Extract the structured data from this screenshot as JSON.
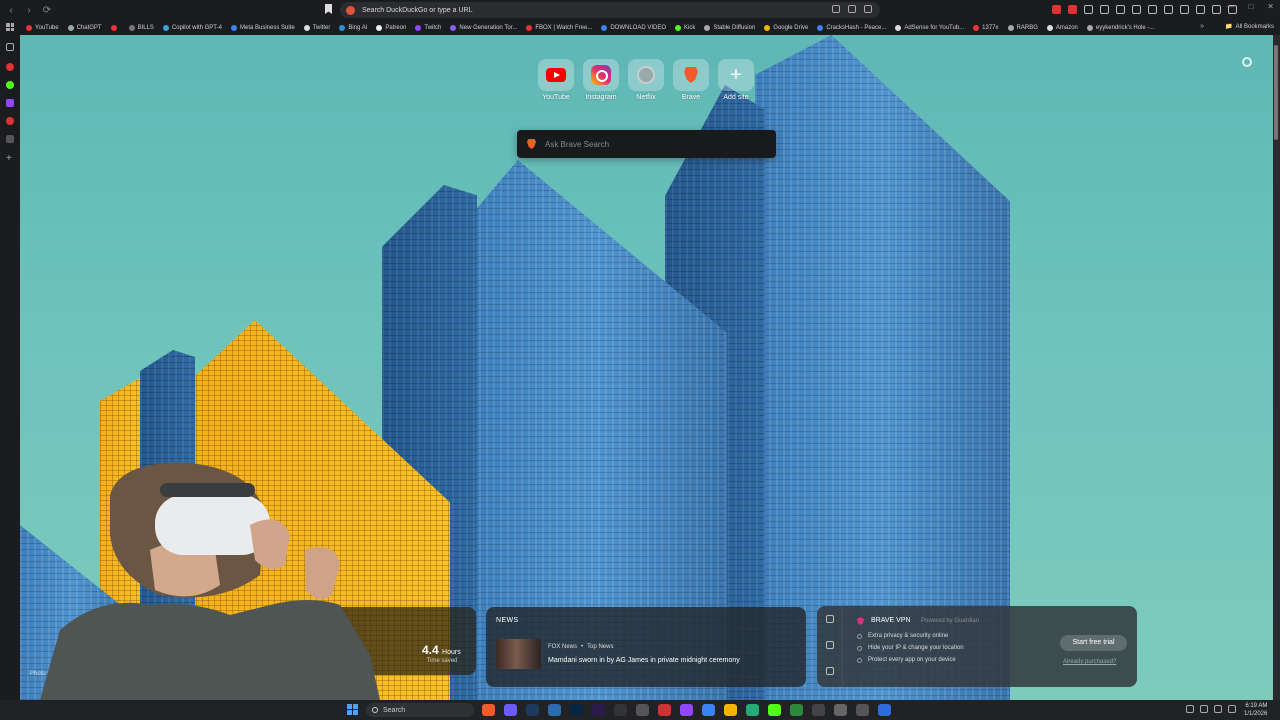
{
  "address_bar": {
    "placeholder": "Search DuckDuckGo or type a URL"
  },
  "bookmarks": [
    {
      "label": "YouTube",
      "color": "#e33"
    },
    {
      "label": "ChatGPT",
      "color": "#9aa"
    },
    {
      "label": "",
      "color": "#e33"
    },
    {
      "label": "BILLS",
      "color": "#777"
    },
    {
      "label": "Copilot with GPT-4",
      "color": "#3aa0e0"
    },
    {
      "label": "Meta Business Suite",
      "color": "#3b82f6"
    },
    {
      "label": "Twitter",
      "color": "#ddd"
    },
    {
      "label": "Bing AI",
      "color": "#2b8fd8"
    },
    {
      "label": "Patreon",
      "color": "#eee"
    },
    {
      "label": "Twitch",
      "color": "#9146ff"
    },
    {
      "label": "New Generation Tor...",
      "color": "#8b5cf6"
    },
    {
      "label": "FBOX | Watch Free...",
      "color": "#e33"
    },
    {
      "label": "DOWNLOAD VIDEO",
      "color": "#3b82f6"
    },
    {
      "label": "Kick",
      "color": "#53fc18"
    },
    {
      "label": "Stable Diffusion",
      "color": "#aaa"
    },
    {
      "label": "Google Drive",
      "color": "#f4b400"
    },
    {
      "label": "CracksHash - Peace...",
      "color": "#3b82f6"
    },
    {
      "label": "AdSense for YouTub...",
      "color": "#ddd"
    },
    {
      "label": "1377x",
      "color": "#e33"
    },
    {
      "label": "RARBG",
      "color": "#aaa"
    },
    {
      "label": "Amazon",
      "color": "#ddd"
    },
    {
      "label": "eyykendrick's Hole -...",
      "color": "#aaa"
    }
  ],
  "all_bookmarks_label": "All Bookmarks",
  "top_sites": [
    {
      "label": "YouTube",
      "icon": "youtube-icon"
    },
    {
      "label": "Instagram",
      "icon": "instagram-icon"
    },
    {
      "label": "Netflix",
      "icon": "globe-icon"
    },
    {
      "label": "Brave",
      "icon": "brave-icon"
    },
    {
      "label": "Add site",
      "icon": "plus-icon"
    }
  ],
  "search": {
    "placeholder": "Ask Brave Search"
  },
  "stats": {
    "value": "4.4",
    "unit": "Hours",
    "label": "Time saved"
  },
  "news": {
    "title": "NEWS",
    "source": "FOX News",
    "category": "Top News",
    "headline": "Mamdani sworn in by AG James in private midnight ceremony"
  },
  "vpn": {
    "title": "BRAVE VPN",
    "powered_by": "Powered by Guardian",
    "features": [
      "Extra privacy & security online",
      "Hide your IP & change your location",
      "Protect every app on your device"
    ],
    "cta": "Start free trial",
    "already": "Already purchased?"
  },
  "photo_credit": "Photo by Sim",
  "taskbar": {
    "search_label": "Search",
    "time": "6:19 AM",
    "date": "1/1/2026"
  }
}
